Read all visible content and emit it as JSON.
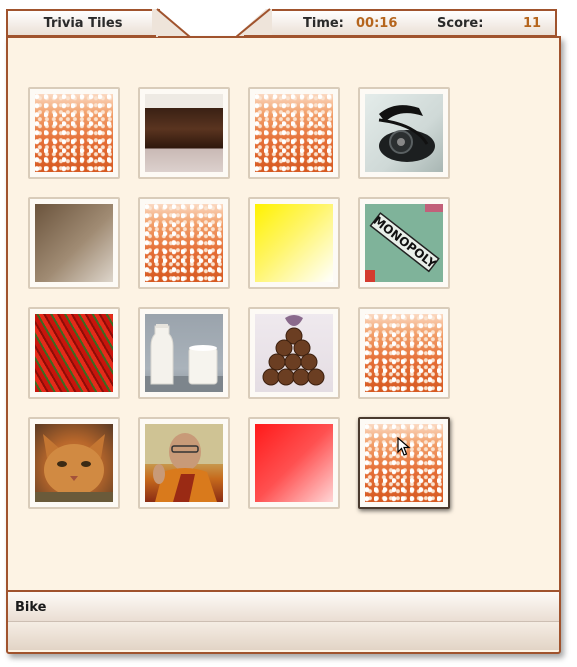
{
  "header": {
    "title": "Trivia Tiles",
    "time_label": "Time:",
    "time_value": "00:16",
    "score_label": "Score:",
    "score_value": "11"
  },
  "tiles": [
    {
      "picture": "face-down-tile",
      "selected": false
    },
    {
      "picture": "chocolate-cake-photo",
      "selected": false
    },
    {
      "picture": "face-down-tile",
      "selected": false
    },
    {
      "picture": "rotary-telephone-photo",
      "selected": false
    },
    {
      "picture": "brown-gradient-swatch",
      "selected": false
    },
    {
      "picture": "face-down-tile",
      "selected": false
    },
    {
      "picture": "yellow-gradient-swatch",
      "selected": false
    },
    {
      "picture": "monopoly-board-photo",
      "selected": false
    },
    {
      "picture": "red-chili-peppers-photo",
      "selected": false
    },
    {
      "picture": "milk-bottle-and-glass-photo",
      "selected": false
    },
    {
      "picture": "chocolate-truffles-photo",
      "selected": false
    },
    {
      "picture": "face-down-tile",
      "selected": false
    },
    {
      "picture": "orange-cat-photo",
      "selected": false
    },
    {
      "picture": "smiling-monk-photo",
      "selected": false
    },
    {
      "picture": "red-gradient-swatch",
      "selected": false
    },
    {
      "picture": "face-down-tile",
      "selected": true
    }
  ],
  "monopoly_text": "MONOPOLY",
  "footer": {
    "target_word": "Bike"
  },
  "colors": {
    "frame_border": "#a0532d",
    "panel_background": "#fdf3e4",
    "hud_value": "#b5651d"
  }
}
